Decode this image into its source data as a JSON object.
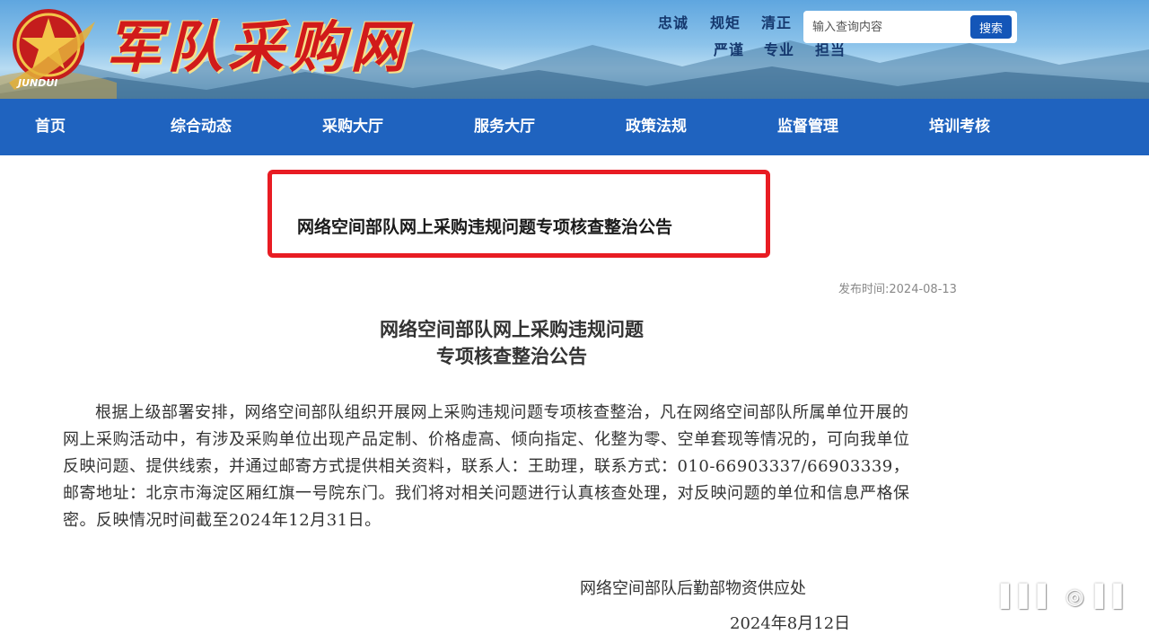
{
  "header": {
    "site_title": "军队采购网",
    "emblem_text": "JUNDUI",
    "slogans": [
      "忠诚",
      "规矩",
      "清正",
      "严谨",
      "专业",
      "担当"
    ]
  },
  "search": {
    "placeholder": "输入查询内容",
    "button_label": "搜索"
  },
  "nav": {
    "items": [
      "首页",
      "综合动态",
      "采购大厅",
      "服务大厅",
      "政策法规",
      "监督管理",
      "培训考核"
    ]
  },
  "notice": {
    "highlight_title": "网络空间部队网上采购违规问题专项核查整治公告",
    "publish_time": "发布时间:2024-08-13",
    "title_line1": "网络空间部队网上采购违规问题",
    "title_line2": "专项核查整治公告",
    "body": "根据上级部署安排，网络空间部队组织开展网上采购违规问题专项核查整治，凡在网络空间部队所属单位开展的网上采购活动中，有涉及采购单位出现产品定制、价格虚高、倾向指定、化整为零、空单套现等情况的，可向我单位反映问题、提供线索，并通过邮寄方式提供相关资料，联系人：王助理，联系方式：010-66903337/66903339，邮寄地址：北京市海淀区厢红旗一号院东门。我们将对相关问题进行认真核查处理，对反映问题的单位和信息严格保密。反映情况时间截至2024年12月31日。",
    "signature": "网络空间部队后勤部物资供应处",
    "sign_date": "2024年8月12日"
  },
  "colors": {
    "nav_bg": "#1f63bf",
    "highlight_border": "#e81c23",
    "search_button": "#1456b8",
    "title_red": "#d11a1a"
  }
}
